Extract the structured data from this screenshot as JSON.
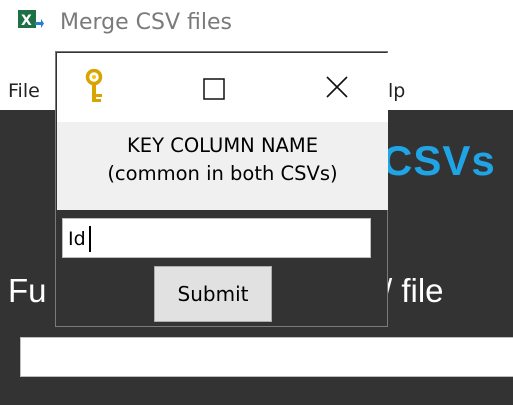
{
  "main_window": {
    "title": "Merge CSV files",
    "menu": {
      "file": "File",
      "help_fragment": "lp"
    },
    "heading_fragment": "CSVs",
    "field_label_left_fragment": "Fu",
    "field_label_right_fragment": "/ file"
  },
  "dialog": {
    "message_line1": "KEY COLUMN NAME",
    "message_line2": "(common in both CSVs)",
    "entry_value": "Id",
    "submit_label": "Submit"
  },
  "colors": {
    "app_background": "#333333",
    "heading": "#1fa4e6",
    "dialog_message_background": "#f0f0f0",
    "button": "#e1e1e1"
  },
  "icons": {
    "app": "excel-icon",
    "dialog": "key-icon",
    "maximize": "maximize-icon",
    "close": "close-icon"
  }
}
